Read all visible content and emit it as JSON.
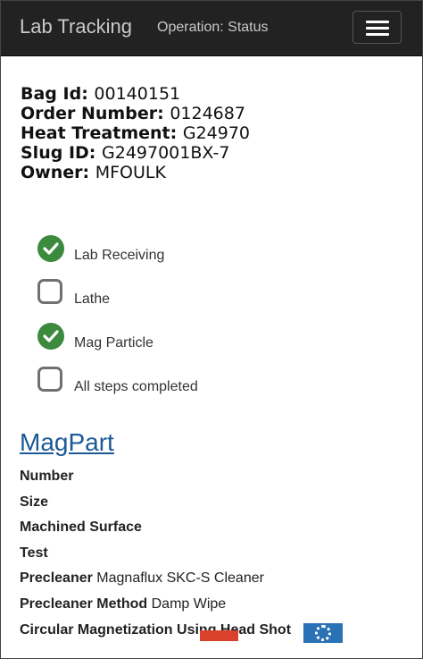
{
  "navbar": {
    "brand": "Lab Tracking",
    "operation": "Operation: Status",
    "menu_icon": "hamburger-icon"
  },
  "bag": {
    "rows": [
      {
        "label": "Bag Id:",
        "value": "00140151"
      },
      {
        "label": "Order Number:",
        "value": "0124687"
      },
      {
        "label": "Heat Treatment:",
        "value": "G24970"
      },
      {
        "label": "Slug ID:",
        "value": "G2497001BX-7"
      },
      {
        "label": "Owner:",
        "value": "MFOULK"
      }
    ]
  },
  "steps": [
    {
      "label": "Lab Receiving",
      "checked": true
    },
    {
      "label": "Lathe",
      "checked": false
    },
    {
      "label": "Mag Particle",
      "checked": true
    },
    {
      "label": "All steps completed",
      "checked": false
    }
  ],
  "section": {
    "heading": "MagPart",
    "fields": [
      {
        "label": "Number",
        "value": ""
      },
      {
        "label": "Size",
        "value": ""
      },
      {
        "label": "Machined Surface",
        "value": ""
      },
      {
        "label": "Test",
        "value": ""
      },
      {
        "label": "Precleaner",
        "value": "Magnaflux SKC-S Cleaner"
      },
      {
        "label": "Precleaner Method",
        "value": "Damp Wipe"
      },
      {
        "label": "Circular Magnetization Using Head Shot",
        "value": ""
      }
    ]
  },
  "colors": {
    "navbar": "#222222",
    "check": "#3b8a3e",
    "link": "#1c5a96"
  }
}
